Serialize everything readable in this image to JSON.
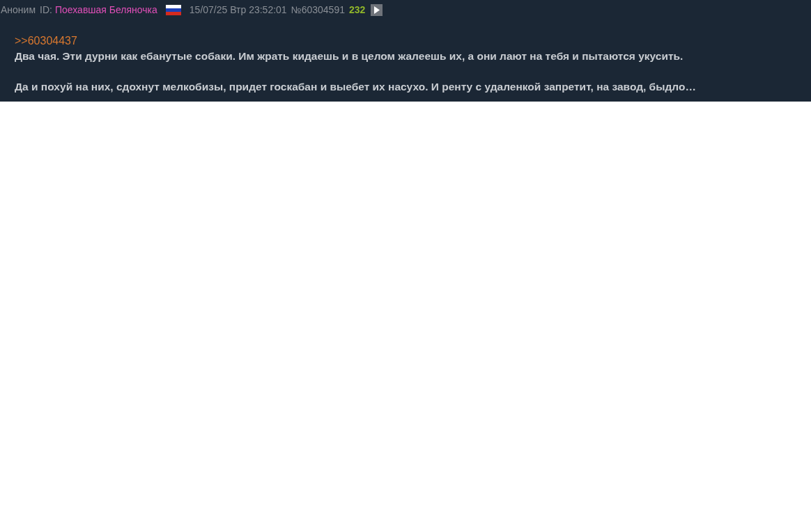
{
  "post": {
    "author": "Аноним",
    "id_label": "ID:",
    "id_name": "Поехавшая Беляночка",
    "date": "15/07/25 Втр 23:52:01",
    "number": "№60304591",
    "count": "232",
    "reply_link": ">>60304437",
    "paragraphs": [
      "Два чая. Эти дурни как ебанутые собаки. Им жрать кидаешь и в целом жалеешь их, а они лают на тебя и пытаются укусить.",
      "Да и похуй на них, сдохнут мелкобизы, придет госкабан и выебет их насухо. И ренту с удаленкой запретит, на завод, быдло…"
    ]
  }
}
